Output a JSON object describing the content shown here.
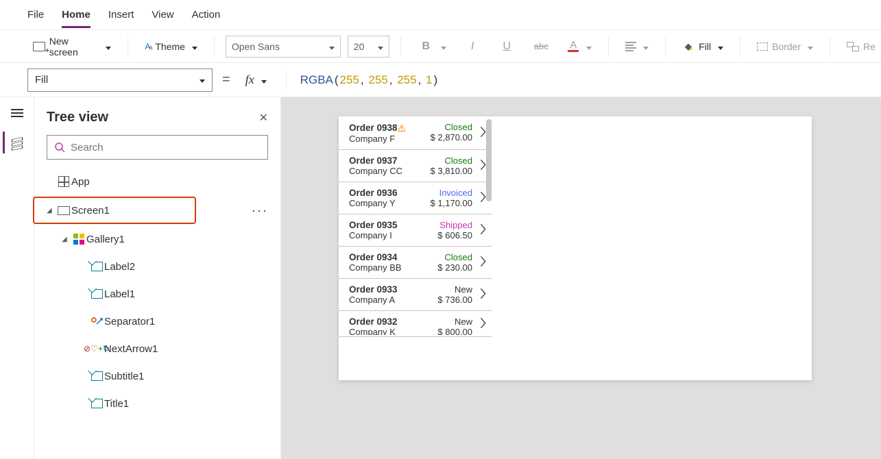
{
  "menu": {
    "tabs": [
      "File",
      "Home",
      "Insert",
      "View",
      "Action"
    ],
    "active": "Home"
  },
  "ribbon": {
    "new_screen": "New screen",
    "theme": "Theme",
    "font_name": "Open Sans",
    "font_size": "20",
    "fill": "Fill",
    "border": "Border",
    "reorder_short": "Re"
  },
  "formula": {
    "property": "Fill",
    "fx": "fx",
    "fn": "RGBA",
    "args": [
      "255",
      "255",
      "255",
      "1"
    ]
  },
  "tree": {
    "title": "Tree view",
    "search_placeholder": "Search",
    "ellipsis": "···",
    "nodes": {
      "app": "App",
      "screen1": "Screen1",
      "gallery1": "Gallery1",
      "label2": "Label2",
      "label1": "Label1",
      "separator1": "Separator1",
      "nextarrow1": "NextArrow1",
      "subtitle1": "Subtitle1",
      "title1": "Title1"
    }
  },
  "gallery_items": [
    {
      "order": "Order 0938",
      "company": "Company F",
      "status": "Closed",
      "status_cls": "st-closed",
      "amount": "$ 2,870.00",
      "warn": true
    },
    {
      "order": "Order 0937",
      "company": "Company CC",
      "status": "Closed",
      "status_cls": "st-closed",
      "amount": "$ 3,810.00",
      "warn": false
    },
    {
      "order": "Order 0936",
      "company": "Company Y",
      "status": "Invoiced",
      "status_cls": "st-invoiced",
      "amount": "$ 1,170.00",
      "warn": false
    },
    {
      "order": "Order 0935",
      "company": "Company I",
      "status": "Shipped",
      "status_cls": "st-shipped",
      "amount": "$ 606.50",
      "warn": false
    },
    {
      "order": "Order 0934",
      "company": "Company BB",
      "status": "Closed",
      "status_cls": "st-closed",
      "amount": "$ 230.00",
      "warn": false
    },
    {
      "order": "Order 0933",
      "company": "Company A",
      "status": "New",
      "status_cls": "st-new",
      "amount": "$ 736.00",
      "warn": false
    },
    {
      "order": "Order 0932",
      "company": "Company K",
      "status": "New",
      "status_cls": "st-new",
      "amount": "$ 800.00",
      "warn": false
    }
  ]
}
